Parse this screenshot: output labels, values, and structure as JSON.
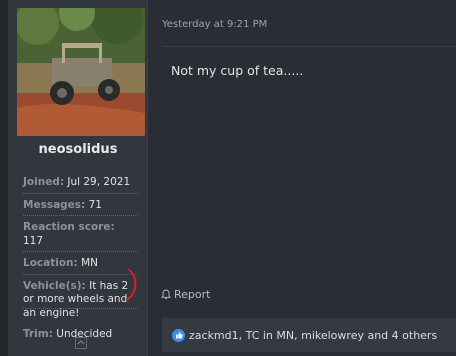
{
  "post": {
    "timestamp": "Yesterday at 9:21 PM",
    "body": "Not my cup of tea.....",
    "report_label": "Report"
  },
  "user": {
    "username": "neosolidus",
    "avatar_icon": "utv-photo-avatar",
    "fields": [
      {
        "key": "Joined:",
        "value": "Jul 29, 2021"
      },
      {
        "key": "Messages:",
        "value": "71"
      },
      {
        "key": "Reaction score:",
        "value": "117"
      },
      {
        "key": "Location:",
        "value": "MN"
      },
      {
        "key": "Vehicle(s):",
        "value": "It has 2 or more wheels and an engine!"
      },
      {
        "key": "Trim:",
        "value": "Undecided"
      }
    ]
  },
  "reactions": {
    "icon": "like-icon",
    "text": "zackmd1, TC in MN, mikelowrey and 4 others",
    "color": "#3b8ee8"
  }
}
